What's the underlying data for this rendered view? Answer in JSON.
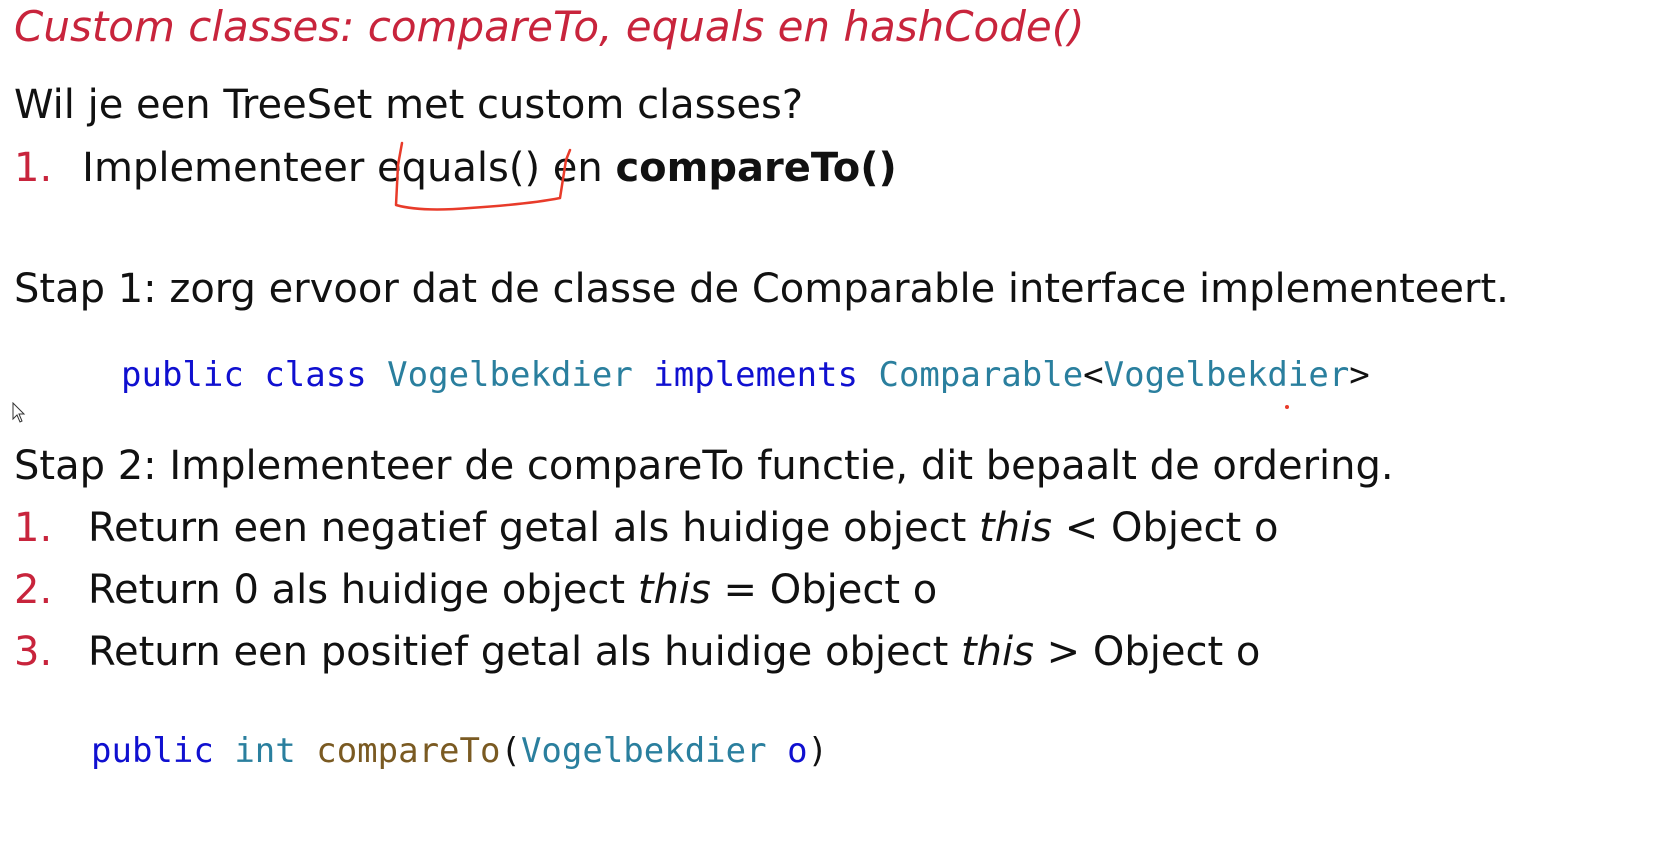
{
  "title": "Custom classes: compareTo, equals en hashCode()",
  "intro": {
    "question": "Wil je een TreeSet met custom classes?",
    "item_number": "1.",
    "item_prefix": "Implementeer ",
    "item_equals": "equals()",
    "item_middle": " en ",
    "item_compare": "compareTo()"
  },
  "step1": {
    "text": "Stap 1: zorg ervoor dat de classe de Comparable interface implementeert.",
    "code": {
      "kw_public": "public",
      "kw_class": "class",
      "class_name": "Vogelbekdier",
      "kw_implements": "implements",
      "iface": "Comparable",
      "lt": "<",
      "type_arg": "Vogelbekdier",
      "gt": ">"
    }
  },
  "step2": {
    "text": "Stap 2: Implementeer de compareTo functie, dit bepaalt de ordering.",
    "items": [
      {
        "number": "1.",
        "before": "Return een negatief getal als huidige object ",
        "emph": "this",
        "after": " < Object o"
      },
      {
        "number": "2.",
        "before": "Return 0 als huidige object ",
        "emph": "this",
        "after": " = Object o"
      },
      {
        "number": "3.",
        "before": "Return een positief getal als huidige object ",
        "emph": "this",
        "after": " > Object o"
      }
    ],
    "code": {
      "kw_public": "public",
      "kw_int": "int",
      "method": "compareTo",
      "open": "(",
      "param_type": "Vogelbekdier",
      "param_name": "o",
      "close": ")"
    }
  },
  "colors": {
    "accent_red": "#c8243c",
    "keyword_blue": "#1010d0",
    "type_teal": "#2a7f9e",
    "method_brown": "#7a5a22",
    "annotation_red": "#e83b2a"
  }
}
